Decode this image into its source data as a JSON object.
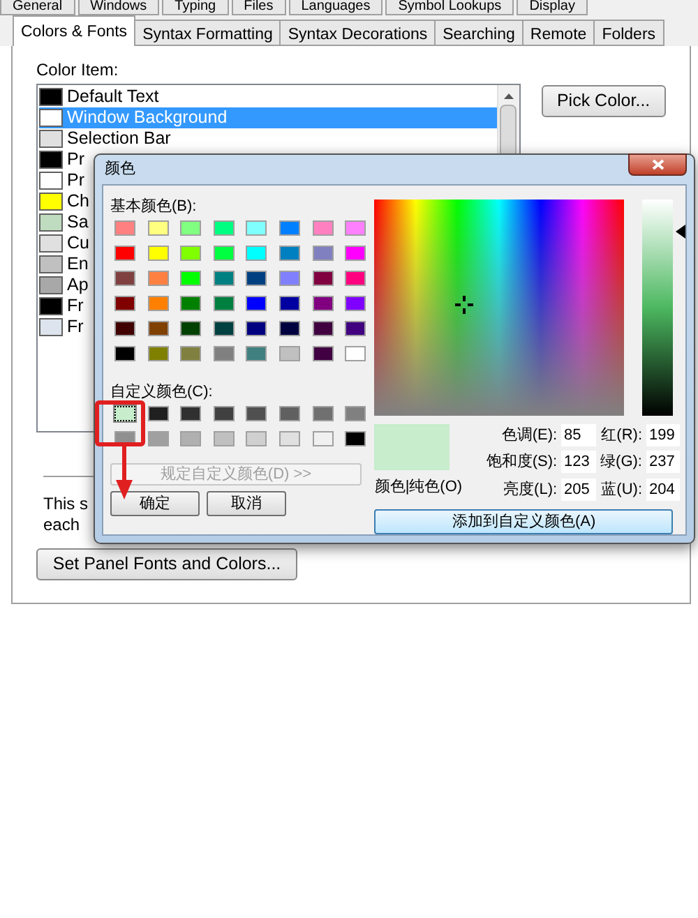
{
  "tabs_row_1": [
    {
      "label": "General",
      "selected": false
    },
    {
      "label": "Windows",
      "selected": false
    },
    {
      "label": "Typing",
      "selected": false
    },
    {
      "label": "Files",
      "selected": false
    },
    {
      "label": "Languages",
      "selected": false
    },
    {
      "label": "Symbol Lookups",
      "selected": false
    },
    {
      "label": "Display",
      "selected": false
    }
  ],
  "tabs_row_2": [
    {
      "label": "Colors & Fonts",
      "selected": true
    },
    {
      "label": "Syntax Formatting",
      "selected": false
    },
    {
      "label": "Syntax Decorations",
      "selected": false
    },
    {
      "label": "Searching",
      "selected": false
    },
    {
      "label": "Remote",
      "selected": false
    },
    {
      "label": "Folders",
      "selected": false
    }
  ],
  "color_item_label": "Color Item:",
  "color_items": [
    {
      "label": "Default Text",
      "color": "#000000",
      "selected": false
    },
    {
      "label": "Window Background",
      "color": "#ffffff",
      "selected": true
    },
    {
      "label": "Selection Bar",
      "color": "#e0e0e0",
      "selected": false
    },
    {
      "label": "Pr",
      "color": "#000000",
      "selected": false
    },
    {
      "label": "Pr",
      "color": "#ffffff",
      "selected": false
    },
    {
      "label": "Ch",
      "color": "#ffff00",
      "selected": false
    },
    {
      "label": "Sa",
      "color": "#c0dcc0",
      "selected": false
    },
    {
      "label": "Cu",
      "color": "#e0e0e0",
      "selected": false
    },
    {
      "label": "En",
      "color": "#c0c0c0",
      "selected": false
    },
    {
      "label": "Ap",
      "color": "#a8a8a8",
      "selected": false
    },
    {
      "label": "Fr",
      "color": "#000000",
      "selected": false
    },
    {
      "label": "Fr",
      "color": "#dde4ee",
      "selected": false
    }
  ],
  "pick_color_button": "Pick Color...",
  "description_lines": [
    "This s",
    "each"
  ],
  "panel_fonts_button": "Set Panel Fonts and Colors...",
  "color_dialog": {
    "title": "颜色",
    "basic_colors_label": "基本颜色(B):",
    "basic_colors": [
      {
        "color": "#ff8080"
      },
      {
        "color": "#ffff80"
      },
      {
        "color": "#80ff80"
      },
      {
        "color": "#00ff80"
      },
      {
        "color": "#80ffff"
      },
      {
        "color": "#0080ff"
      },
      {
        "color": "#ff80c0"
      },
      {
        "color": "#ff80ff"
      },
      {
        "color": "#ff0000"
      },
      {
        "color": "#ffff00"
      },
      {
        "color": "#80ff00"
      },
      {
        "color": "#00ff40"
      },
      {
        "color": "#00ffff"
      },
      {
        "color": "#0080c0"
      },
      {
        "color": "#8080c0"
      },
      {
        "color": "#ff00ff"
      },
      {
        "color": "#804040"
      },
      {
        "color": "#ff8040"
      },
      {
        "color": "#00ff00"
      },
      {
        "color": "#008080"
      },
      {
        "color": "#004080"
      },
      {
        "color": "#8080ff"
      },
      {
        "color": "#800040"
      },
      {
        "color": "#ff0080"
      },
      {
        "color": "#800000"
      },
      {
        "color": "#ff8000"
      },
      {
        "color": "#008000"
      },
      {
        "color": "#008040"
      },
      {
        "color": "#0000ff"
      },
      {
        "color": "#0000a0"
      },
      {
        "color": "#800080"
      },
      {
        "color": "#8000ff"
      },
      {
        "color": "#400000"
      },
      {
        "color": "#804000"
      },
      {
        "color": "#004000"
      },
      {
        "color": "#004040"
      },
      {
        "color": "#000080"
      },
      {
        "color": "#000040"
      },
      {
        "color": "#400040"
      },
      {
        "color": "#400080"
      },
      {
        "color": "#000000"
      },
      {
        "color": "#808000"
      },
      {
        "color": "#808040"
      },
      {
        "color": "#808080"
      },
      {
        "color": "#408080"
      },
      {
        "color": "#c0c0c0"
      },
      {
        "color": "#400041"
      },
      {
        "color": "#ffffff"
      }
    ],
    "custom_colors_label": "自定义颜色(C):",
    "custom_colors": [
      {
        "color": "#c7edcc",
        "selected": true
      },
      {
        "color": "#202020",
        "selected": false
      },
      {
        "color": "#303030",
        "selected": false
      },
      {
        "color": "#404040",
        "selected": false
      },
      {
        "color": "#505050",
        "selected": false
      },
      {
        "color": "#606060",
        "selected": false
      },
      {
        "color": "#707070",
        "selected": false
      },
      {
        "color": "#808080",
        "selected": false
      },
      {
        "color": "#909090",
        "selected": false
      },
      {
        "color": "#a0a0a0",
        "selected": false
      },
      {
        "color": "#b0b0b0",
        "selected": false
      },
      {
        "color": "#c0c0c0",
        "selected": false
      },
      {
        "color": "#d0d0d0",
        "selected": false
      },
      {
        "color": "#e0e0e0",
        "selected": false
      },
      {
        "color": "#f0f0f0",
        "selected": false
      },
      {
        "color": "#000000",
        "selected": false
      }
    ],
    "define_button": {
      "label": "规定自定义颜色(D) >>",
      "disabled": true
    },
    "ok_button": "确定",
    "cancel_button": "取消",
    "luminance_slider": {
      "level": 0.85
    },
    "preview_label": "颜色|纯色(O)",
    "fields": [
      {
        "label": "色调(E):",
        "value": "85"
      },
      {
        "label": "红(R):",
        "value": "199"
      },
      {
        "label": "饱和度(S):",
        "value": "123"
      },
      {
        "label": "绿(G):",
        "value": "237"
      },
      {
        "label": "亮度(L):",
        "value": "205"
      },
      {
        "label": "蓝(U):",
        "value": "204"
      }
    ],
    "add_button": "添加到自定义颜色(A)"
  }
}
